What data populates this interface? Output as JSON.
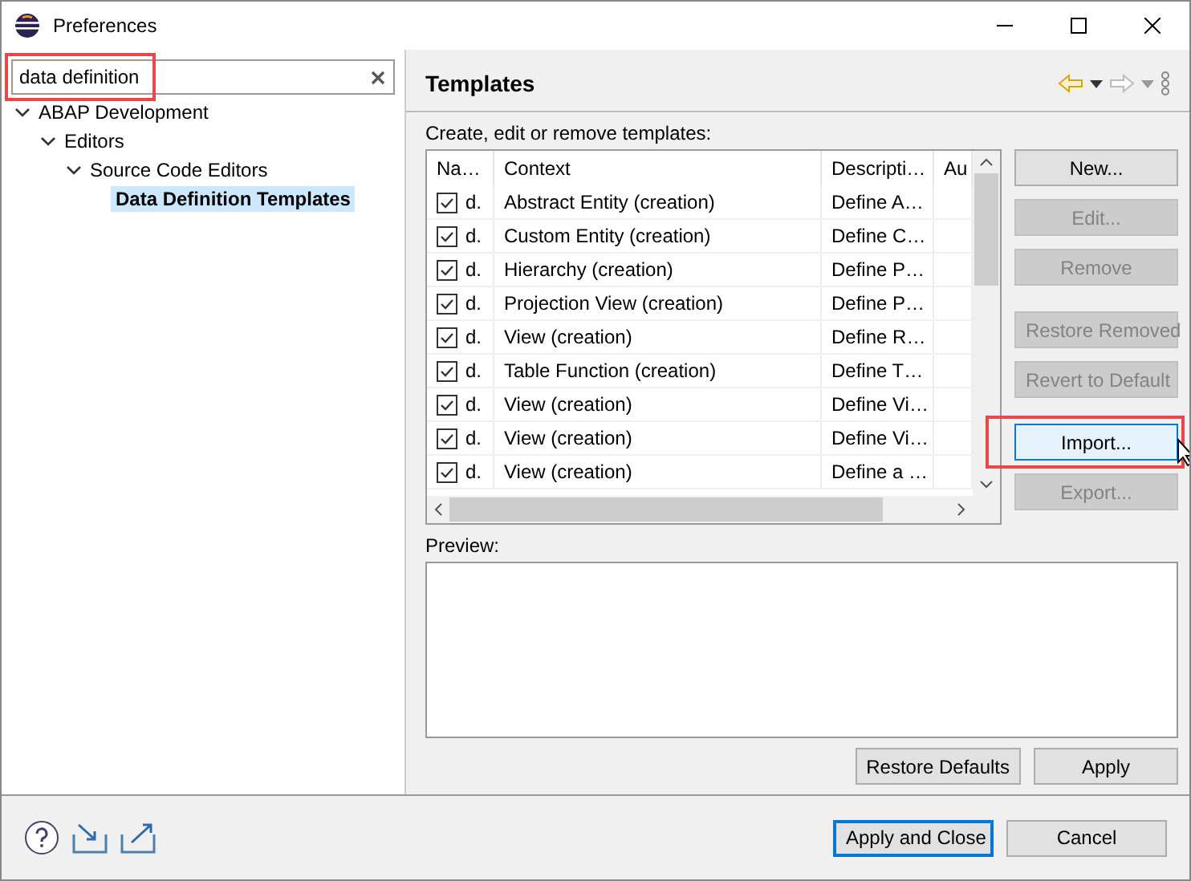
{
  "window": {
    "title": "Preferences"
  },
  "search": {
    "value": "data definition",
    "highlighted": true
  },
  "tree": [
    {
      "label": "ABAP Development",
      "expanded": true,
      "selected": false,
      "children": [
        {
          "label": "Editors",
          "expanded": true,
          "selected": false,
          "children": [
            {
              "label": "Source Code Editors",
              "expanded": true,
              "selected": false,
              "children": [
                {
                  "label": "Data Definition Templates",
                  "selected": true
                }
              ]
            }
          ]
        }
      ]
    }
  ],
  "page": {
    "title": "Templates",
    "description": "Create, edit or remove templates:"
  },
  "table": {
    "columns": [
      "Na…",
      "Context",
      "Descripti…",
      "Au"
    ],
    "rows": [
      {
        "checked": true,
        "name": "d.",
        "context": "Abstract Entity (creation)",
        "description": "Define A…"
      },
      {
        "checked": true,
        "name": "d.",
        "context": "Custom Entity (creation)",
        "description": "Define C…"
      },
      {
        "checked": true,
        "name": "d.",
        "context": "Hierarchy (creation)",
        "description": "Define P…"
      },
      {
        "checked": true,
        "name": "d.",
        "context": "Projection View (creation)",
        "description": "Define P…"
      },
      {
        "checked": true,
        "name": "d.",
        "context": "View (creation)",
        "description": "Define R…"
      },
      {
        "checked": true,
        "name": "d.",
        "context": "Table Function (creation)",
        "description": "Define T…"
      },
      {
        "checked": true,
        "name": "d.",
        "context": "View (creation)",
        "description": "Define Vi…"
      },
      {
        "checked": true,
        "name": "d.",
        "context": "View (creation)",
        "description": "Define Vi…"
      },
      {
        "checked": true,
        "name": "d.",
        "context": "View (creation)",
        "description": "Define a …"
      }
    ]
  },
  "side_buttons": [
    {
      "label": "New...",
      "disabled": false,
      "focused": false,
      "highlighted": false,
      "hovered": false
    },
    {
      "label": "Edit...",
      "disabled": true,
      "focused": false,
      "highlighted": false,
      "hovered": false
    },
    {
      "label": "Remove",
      "disabled": true,
      "focused": false,
      "highlighted": false,
      "hovered": false
    },
    {
      "label": "Restore Removed",
      "disabled": true,
      "focused": false,
      "highlighted": false,
      "hovered": false
    },
    {
      "label": "Revert to Default",
      "disabled": true,
      "focused": false,
      "highlighted": false,
      "hovered": false
    },
    {
      "label": "Import...",
      "disabled": false,
      "focused": true,
      "highlighted": true,
      "hovered": true
    },
    {
      "label": "Export...",
      "disabled": true,
      "focused": false,
      "highlighted": false,
      "hovered": false
    }
  ],
  "preview": {
    "label": "Preview:"
  },
  "page_buttons": [
    "Restore Defaults",
    "Apply"
  ],
  "footer_buttons": [
    {
      "label": "Apply and Close",
      "default": true
    },
    {
      "label": "Cancel",
      "default": false
    }
  ]
}
